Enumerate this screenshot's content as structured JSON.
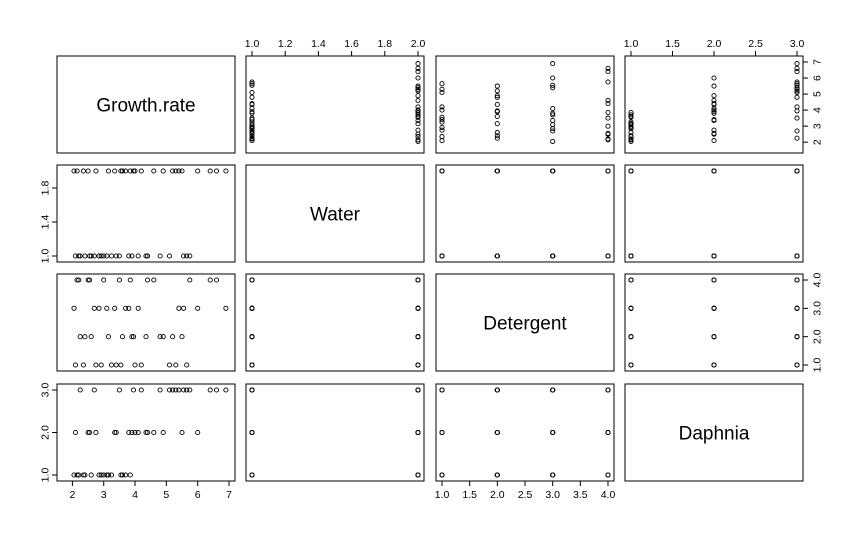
{
  "chart_data": {
    "type": "scatter",
    "subtype": "scatterplot-matrix",
    "variables": [
      "Growth.rate",
      "Water",
      "Detergent",
      "Daphnia"
    ],
    "ranges": {
      "Growth.rate": [
        1.7,
        7.0
      ],
      "Water": [
        1.0,
        2.0
      ],
      "Detergent": [
        1.0,
        4.0
      ],
      "Daphnia": [
        1.0,
        3.0
      ]
    },
    "ticks": {
      "Growth.rate": [
        2,
        3,
        4,
        5,
        6,
        7
      ],
      "Water": [
        1.0,
        1.2,
        1.4,
        1.6,
        1.8,
        2.0
      ],
      "Detergent": [
        1.0,
        1.5,
        2.0,
        2.5,
        3.0,
        3.5,
        4.0
      ],
      "Daphnia": [
        1.0,
        1.5,
        2.0,
        2.5,
        3.0
      ]
    },
    "panel_ticks": {
      "Water": [
        1.0,
        1.4,
        1.8
      ],
      "Detergent": [
        1.0,
        2.0,
        3.0,
        4.0
      ],
      "Daphnia": [
        1.0,
        2.0,
        3.0
      ]
    },
    "tick_labels": {
      "Growth.rate": [
        "2",
        "3",
        "4",
        "5",
        "6",
        "7"
      ],
      "Water": [
        "1.0",
        "1.2",
        "1.4",
        "1.6",
        "1.8",
        "2.0"
      ],
      "Detergent": [
        "1.0",
        "1.5",
        "2.0",
        "2.5",
        "3.0",
        "3.5",
        "4.0"
      ],
      "Daphnia": [
        "1.0",
        "1.5",
        "2.0",
        "2.5",
        "3.0"
      ]
    },
    "panel_tick_labels": {
      "Water": [
        "1.0",
        "1.4",
        "1.8"
      ],
      "Detergent": [
        "1.0",
        "2.0",
        "3.0",
        "4.0"
      ],
      "Daphnia": [
        "1.0",
        "2.0",
        "3.0"
      ]
    },
    "growth_rate_axis_ticks": [
      2,
      3,
      4,
      5,
      6,
      7
    ],
    "growth_rate_axis_labels": [
      "2",
      "3",
      "4",
      "5",
      "6",
      "7"
    ],
    "observations": [
      [
        2.92,
        1,
        1,
        1
      ],
      [
        3.25,
        1,
        1,
        1
      ],
      [
        2.1,
        1,
        1,
        2
      ],
      [
        3.4,
        1,
        1,
        2
      ],
      [
        5.65,
        1,
        1,
        3
      ],
      [
        5.1,
        1,
        1,
        3
      ],
      [
        2.6,
        1,
        2,
        1
      ],
      [
        2.4,
        1,
        2,
        1
      ],
      [
        3.9,
        1,
        2,
        2
      ],
      [
        4.35,
        1,
        2,
        2
      ],
      [
        4.8,
        1,
        2,
        3
      ],
      [
        2.25,
        1,
        2,
        3
      ],
      [
        3.1,
        1,
        3,
        1
      ],
      [
        2.85,
        1,
        3,
        1
      ],
      [
        4.1,
        1,
        3,
        2
      ],
      [
        3.8,
        1,
        3,
        2
      ],
      [
        5.55,
        1,
        3,
        3
      ],
      [
        2.7,
        1,
        3,
        3
      ],
      [
        3.0,
        1,
        4,
        1
      ],
      [
        2.2,
        1,
        4,
        1
      ],
      [
        2.55,
        1,
        4,
        2
      ],
      [
        4.4,
        1,
        4,
        2
      ],
      [
        5.75,
        1,
        4,
        3
      ],
      [
        3.5,
        1,
        4,
        3
      ],
      [
        2.35,
        2,
        1,
        1
      ],
      [
        3.55,
        2,
        1,
        1
      ],
      [
        2.75,
        2,
        1,
        2
      ],
      [
        4.0,
        2,
        1,
        2
      ],
      [
        5.3,
        2,
        1,
        3
      ],
      [
        4.2,
        2,
        1,
        3
      ],
      [
        3.6,
        2,
        2,
        1
      ],
      [
        3.15,
        2,
        2,
        1
      ],
      [
        5.5,
        2,
        2,
        2
      ],
      [
        4.9,
        2,
        2,
        2
      ],
      [
        3.95,
        2,
        2,
        3
      ],
      [
        5.2,
        2,
        2,
        3
      ],
      [
        2.05,
        2,
        3,
        1
      ],
      [
        3.7,
        2,
        3,
        1
      ],
      [
        6.0,
        2,
        3,
        2
      ],
      [
        3.35,
        2,
        3,
        2
      ],
      [
        5.4,
        2,
        3,
        3
      ],
      [
        6.9,
        2,
        3,
        3
      ],
      [
        2.15,
        2,
        4,
        1
      ],
      [
        3.85,
        2,
        4,
        1
      ],
      [
        4.6,
        2,
        4,
        2
      ],
      [
        2.5,
        2,
        4,
        2
      ],
      [
        6.4,
        2,
        4,
        3
      ],
      [
        6.6,
        2,
        4,
        3
      ]
    ]
  }
}
